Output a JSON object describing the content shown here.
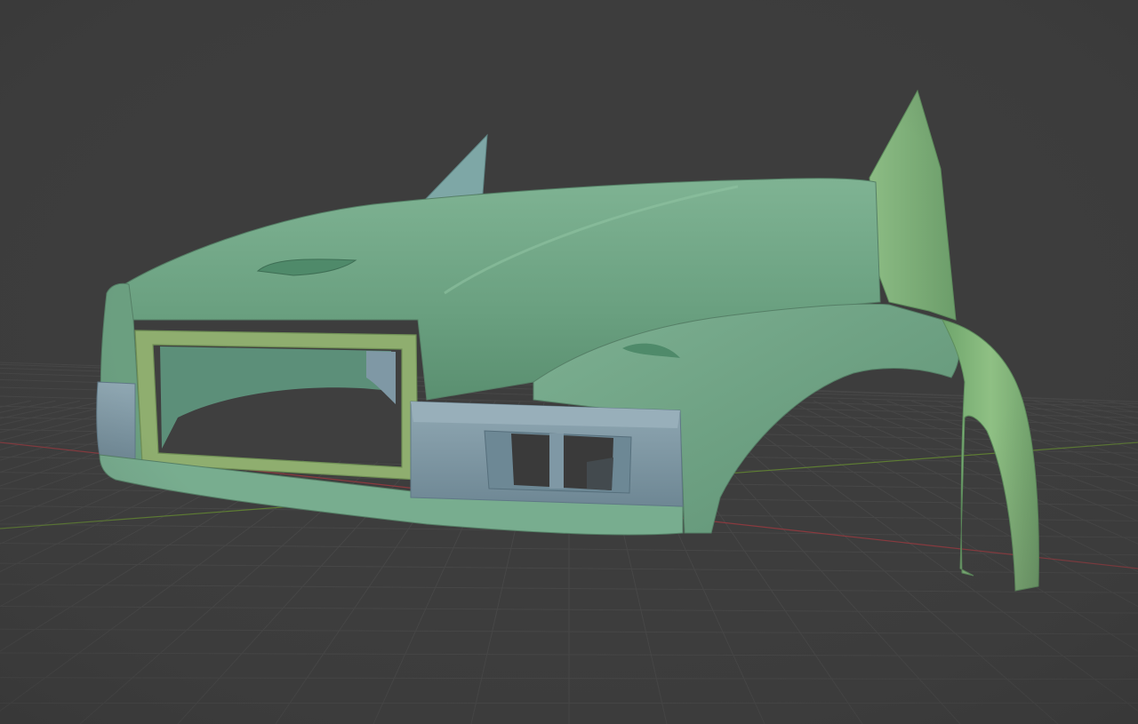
{
  "app": {
    "view": "3d-viewport",
    "shading": "solid"
  },
  "colors": {
    "background": "#3d3d3d",
    "grid_line": "#474747",
    "x_axis": "#8a3a3f",
    "y_axis": "#5e7d33",
    "body_green": "#6fa586",
    "body_green_light": "#8cbd9e",
    "body_green_dark": "#4f7f63",
    "grille_frame": "#8fae6f",
    "bumper_blue": "#7f98a5",
    "bumper_blue_dark": "#5f7886",
    "fender_flare": "#82b17a"
  },
  "scene": {
    "objects": [
      {
        "name": "hood",
        "color": "#6fa586"
      },
      {
        "name": "grille-frame",
        "color": "#8fae6f"
      },
      {
        "name": "bumper",
        "color": "#7f98a5"
      },
      {
        "name": "fender-flare",
        "color": "#82b17a"
      },
      {
        "name": "side-panel",
        "color": "#6fa586"
      }
    ]
  }
}
